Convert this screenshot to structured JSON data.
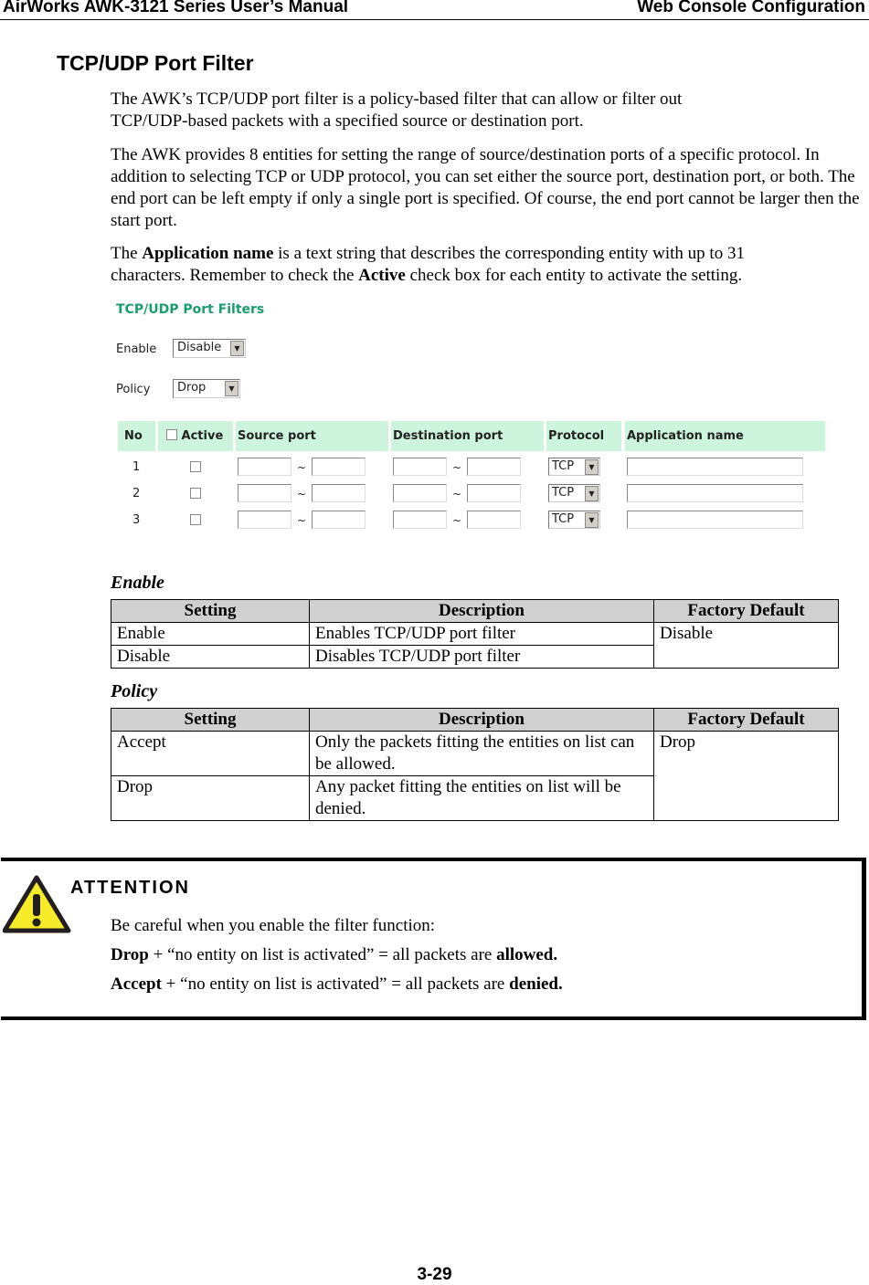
{
  "header": {
    "left": "AirWorks AWK-3121 Series User’s Manual",
    "right": "Web Console Configuration"
  },
  "section_title": "TCP/UDP Port Filter",
  "paragraphs": {
    "p1": "The AWK’s TCP/UDP port filter is a policy-based filter that can allow or filter out TCP/UDP-based packets with a specified source or destination port.",
    "p2": "The AWK provides 8 entities for setting the range of source/destination ports of a specific protocol. In addition to selecting TCP or UDP protocol, you can set either the source port, destination port, or both. The end port can be left empty if only a single port is specified. Of course, the end port cannot be larger then the start port.",
    "p3a": "The ",
    "p3b": "Application name",
    "p3c": " is a text string that describes the corresponding entity with up to 31 characters. Remember to check the ",
    "p3d": "Active",
    "p3e": " check box for each entity to activate the setting."
  },
  "ui": {
    "title": "TCP/UDP Port Filters",
    "enable_label": "Enable",
    "enable_value": "Disable",
    "policy_label": "Policy",
    "policy_value": "Drop",
    "columns": [
      "No",
      "Active",
      "Source port",
      "Destination port",
      "Protocol",
      "Application name"
    ],
    "rows": [
      {
        "no": "1",
        "protocol": "TCP"
      },
      {
        "no": "2",
        "protocol": "TCP"
      },
      {
        "no": "3",
        "protocol": "TCP"
      }
    ],
    "tilde": "~"
  },
  "enable_table": {
    "caption": "Enable",
    "headers": [
      "Setting",
      "Description",
      "Factory Default"
    ],
    "rows": [
      [
        "Enable",
        "Enables TCP/UDP port filter"
      ],
      [
        "Disable",
        "Disables TCP/UDP port filter"
      ]
    ],
    "default": "Disable"
  },
  "policy_table": {
    "caption": "Policy",
    "headers": [
      "Setting",
      "Description",
      "Factory Default"
    ],
    "rows": [
      [
        "Accept",
        "Only the packets fitting the entities on list can be allowed."
      ],
      [
        "Drop",
        "Any packet fitting the entities on list will be denied."
      ]
    ],
    "default": "Drop"
  },
  "attention": {
    "title": "ATTENTION",
    "line1": "Be careful when you enable the filter function:",
    "l2a": "Drop",
    "l2b": " + “no entity on list is activated” = all packets are ",
    "l2c": "allowed.",
    "l3a": "Accept",
    "l3b": " + “no entity on list is activated” = all packets are ",
    "l3c": "denied."
  },
  "page_number": "3-29"
}
